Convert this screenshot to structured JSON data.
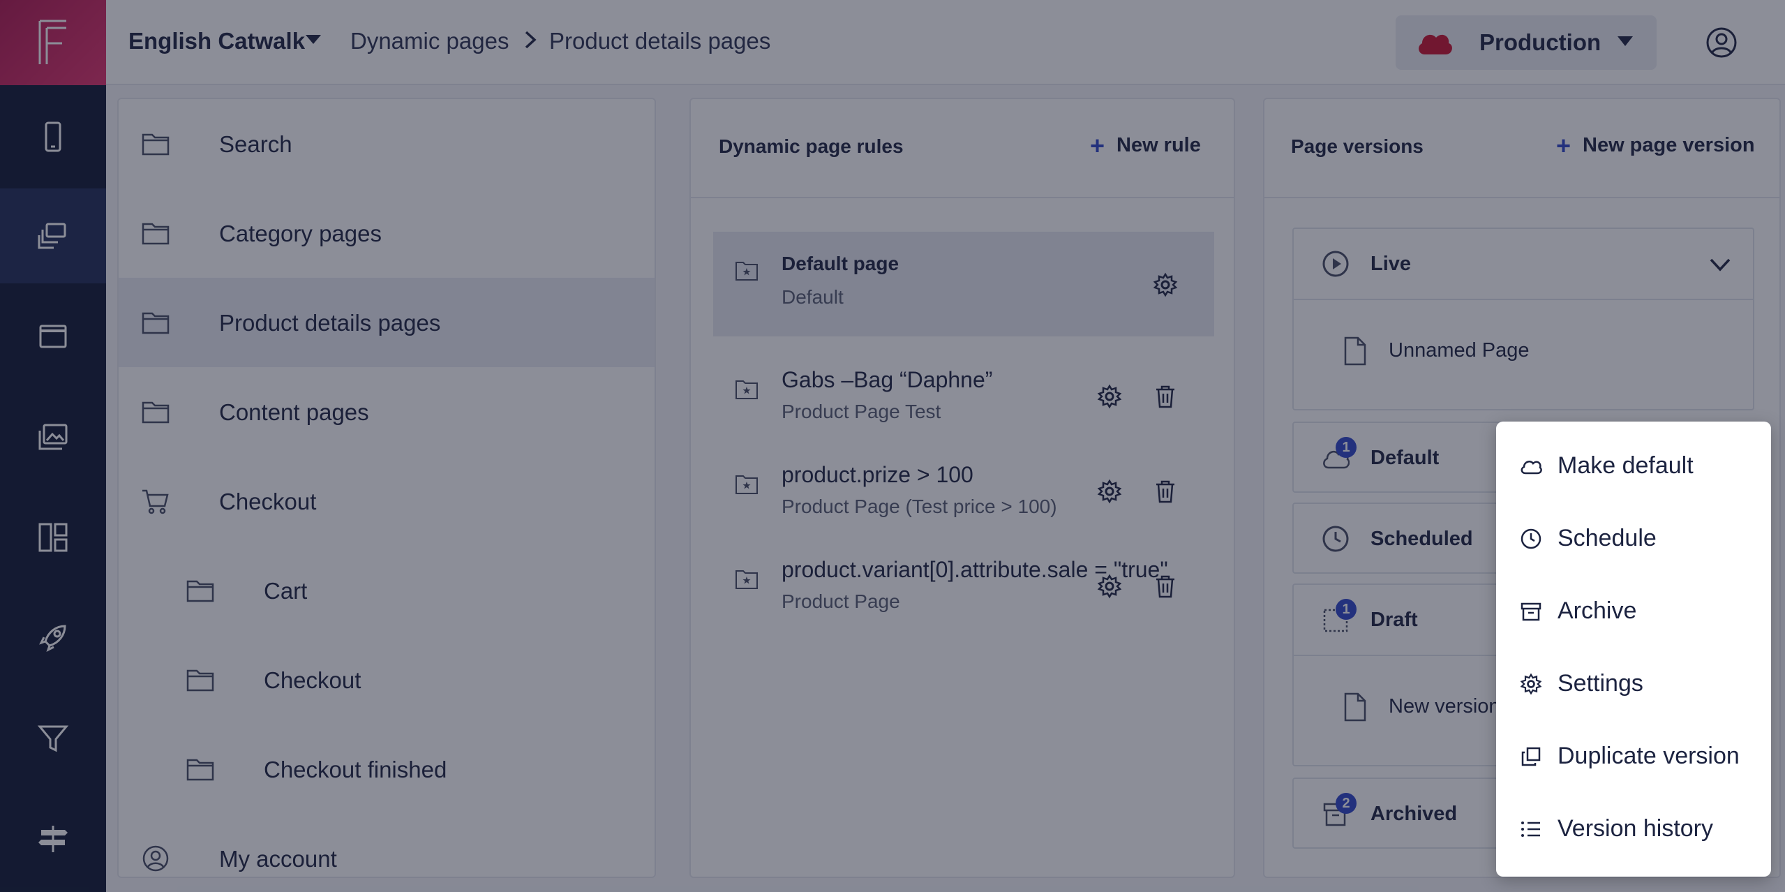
{
  "app": {
    "project": "English Catwalk",
    "breadcrumb": [
      "Dynamic pages",
      "Product details pages"
    ],
    "environment": "Production",
    "colors": {
      "rail": "#0f1733",
      "brand": "#e0306b",
      "accent": "#2c45c9",
      "env_cloud": "#c8102e"
    }
  },
  "rail": {
    "items": [
      "mobile-icon",
      "dynamic-pages-icon",
      "browser-window-icon",
      "media-icon",
      "layout-icon",
      "rocket-icon",
      "filter-icon",
      "signpost-icon"
    ],
    "active": "dynamic-pages-icon"
  },
  "tree": {
    "items": [
      {
        "label": "Search",
        "icon": "folder-icon",
        "indent": 0
      },
      {
        "label": "Category pages",
        "icon": "folder-icon",
        "indent": 0
      },
      {
        "label": "Product details pages",
        "icon": "folder-icon",
        "indent": 0,
        "selected": true
      },
      {
        "label": "Content pages",
        "icon": "folder-icon",
        "indent": 0
      },
      {
        "label": "Checkout",
        "icon": "cart-icon",
        "indent": 0
      },
      {
        "label": "Cart",
        "icon": "folder-icon",
        "indent": 1
      },
      {
        "label": "Checkout",
        "icon": "folder-icon",
        "indent": 1
      },
      {
        "label": "Checkout finished",
        "icon": "folder-icon",
        "indent": 1
      },
      {
        "label": "My account",
        "icon": "user-icon",
        "indent": 0
      }
    ]
  },
  "rules": {
    "title": "Dynamic page rules",
    "new_label": "New rule",
    "items": [
      {
        "title": "Default page",
        "subtitle": "Default",
        "selected": true
      },
      {
        "title": "Gabs –Bag “Daphne”",
        "subtitle": "Product Page Test"
      },
      {
        "title": "product.prize > 100",
        "subtitle": "Product Page (Test price > 100)"
      },
      {
        "title": "product.variant[0].attribute.sale = \"true\"",
        "subtitle": "Product Page"
      }
    ]
  },
  "versions": {
    "title": "Page versions",
    "new_label": "New page version",
    "groups": [
      {
        "label": "Live",
        "icon": "play-circle-icon",
        "items": [
          "Unnamed Page"
        ]
      },
      {
        "label": "Default",
        "icon": "cloud-icon",
        "badge": "1"
      },
      {
        "label": "Scheduled",
        "icon": "clock-icon"
      },
      {
        "label": "Draft",
        "icon": "draft-icon",
        "badge": "1",
        "items": [
          "New version"
        ]
      },
      {
        "label": "Archived",
        "icon": "archive-icon",
        "badge": "2"
      }
    ]
  },
  "menu": {
    "items": [
      {
        "label": "Make default",
        "icon": "cloud-icon",
        "highlight": true
      },
      {
        "label": "Schedule",
        "icon": "clock-icon"
      },
      {
        "label": "Archive",
        "icon": "archive-icon"
      },
      {
        "label": "Settings",
        "icon": "gear-icon"
      },
      {
        "label": "Duplicate version",
        "icon": "duplicate-icon"
      },
      {
        "label": "Version history",
        "icon": "list-icon"
      }
    ]
  }
}
